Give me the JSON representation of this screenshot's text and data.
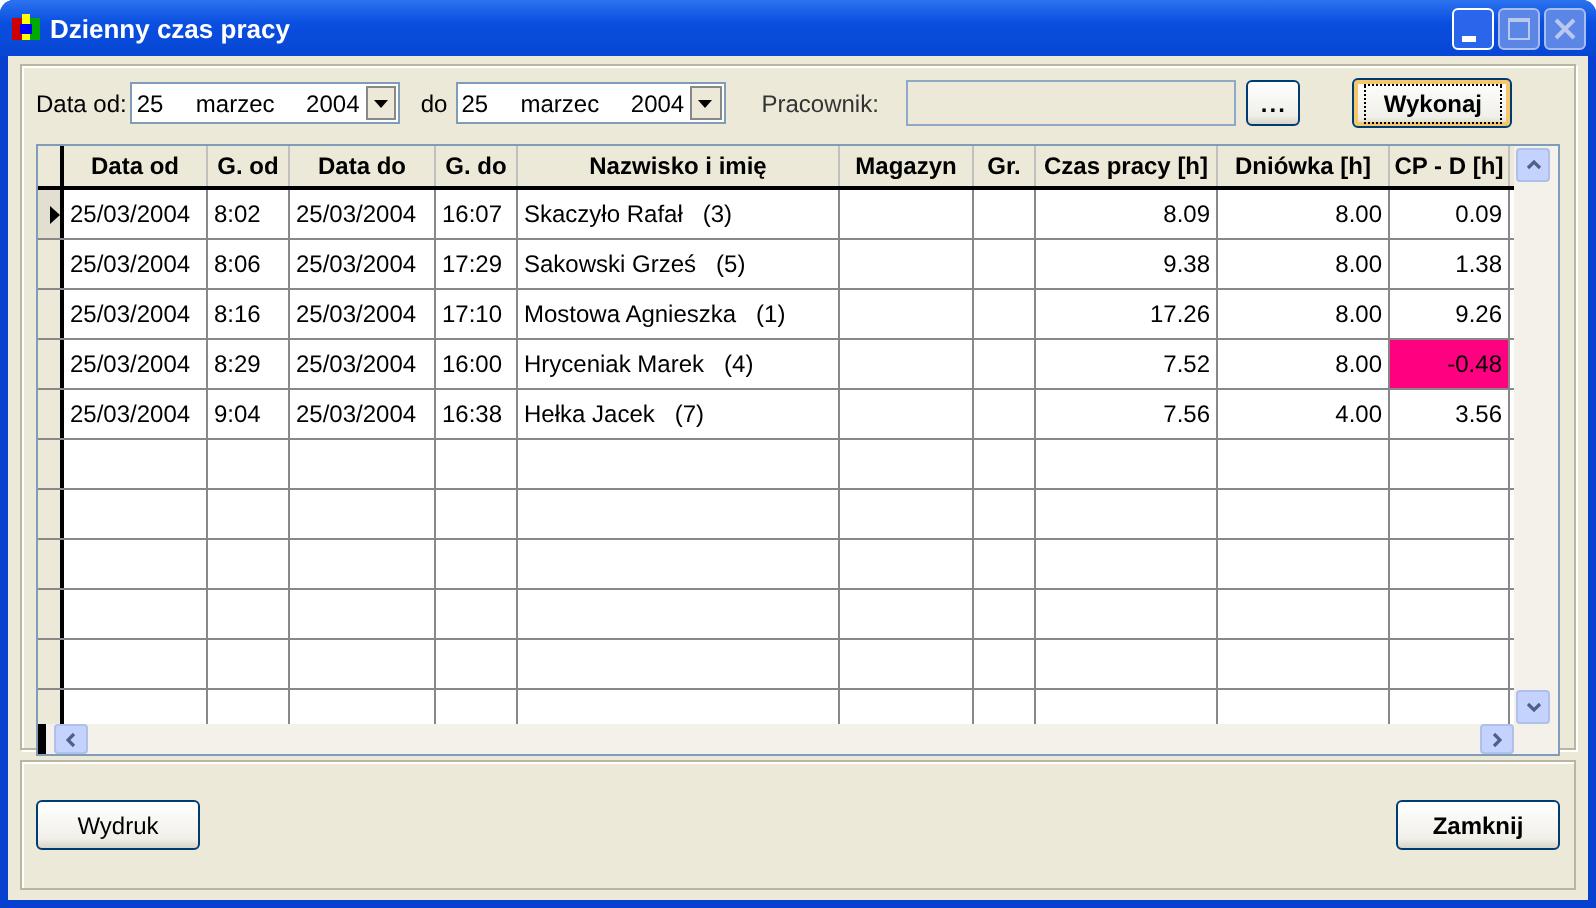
{
  "window": {
    "title": "Dzienny czas pracy"
  },
  "filter": {
    "date_from_label": "Data od:",
    "date_from": {
      "day": "25",
      "month": "marzec",
      "year": "2004"
    },
    "date_to_label": "do",
    "date_to": {
      "day": "25",
      "month": "marzec",
      "year": "2004"
    },
    "employee_label": "Pracownik:",
    "browse_button": "...",
    "run_button": "Wykonaj"
  },
  "table": {
    "columns": [
      "Data od",
      "G. od",
      "Data do",
      "G. do",
      "Nazwisko i imię",
      "Magazyn",
      "Gr.",
      "Czas pracy [h]",
      "Dniówka [h]",
      "CP - D [h]"
    ],
    "rows": [
      {
        "selected": true,
        "cells": [
          "25/03/2004",
          "8:02",
          "25/03/2004",
          "16:07",
          "Skaczyło Rafał   (3)",
          "",
          "",
          "8.09",
          "8.00",
          "0.09"
        ],
        "negative": false
      },
      {
        "selected": false,
        "cells": [
          "25/03/2004",
          "8:06",
          "25/03/2004",
          "17:29",
          "Sakowski Grześ   (5)",
          "",
          "",
          "9.38",
          "8.00",
          "1.38"
        ],
        "negative": false
      },
      {
        "selected": false,
        "cells": [
          "25/03/2004",
          "8:16",
          "25/03/2004",
          "17:10",
          "Mostowa Agnieszka   (1)",
          "",
          "",
          "17.26",
          "8.00",
          "9.26"
        ],
        "negative": false
      },
      {
        "selected": false,
        "cells": [
          "25/03/2004",
          "8:29",
          "25/03/2004",
          "16:00",
          "Hryceniak Marek   (4)",
          "",
          "",
          "7.52",
          "8.00",
          "-0.48"
        ],
        "negative": true
      },
      {
        "selected": false,
        "cells": [
          "25/03/2004",
          "9:04",
          "25/03/2004",
          "16:38",
          "Hełka Jacek   (7)",
          "",
          "",
          "7.56",
          "4.00",
          "3.56"
        ],
        "negative": false
      }
    ]
  },
  "buttons": {
    "print": "Wydruk",
    "close": "Zamknij"
  }
}
